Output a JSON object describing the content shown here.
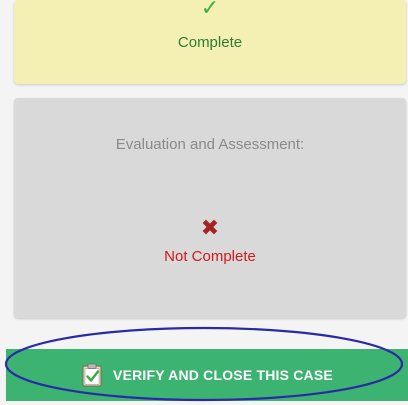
{
  "cards": {
    "complete": {
      "icon": "checkmark-icon",
      "status": "Complete"
    },
    "evaluation": {
      "title": "Evaluation and Assessment:",
      "icon": "x-icon",
      "status": "Not Complete"
    }
  },
  "verify_button": {
    "icon": "clipboard-check-icon",
    "label": "VERIFY AND CLOSE THIS CASE"
  },
  "colors": {
    "complete_bg": "#f4f0b4",
    "incomplete_bg": "#d9d9d9",
    "button_bg": "#3cb371",
    "highlight_ellipse": "#2a2aa6"
  }
}
